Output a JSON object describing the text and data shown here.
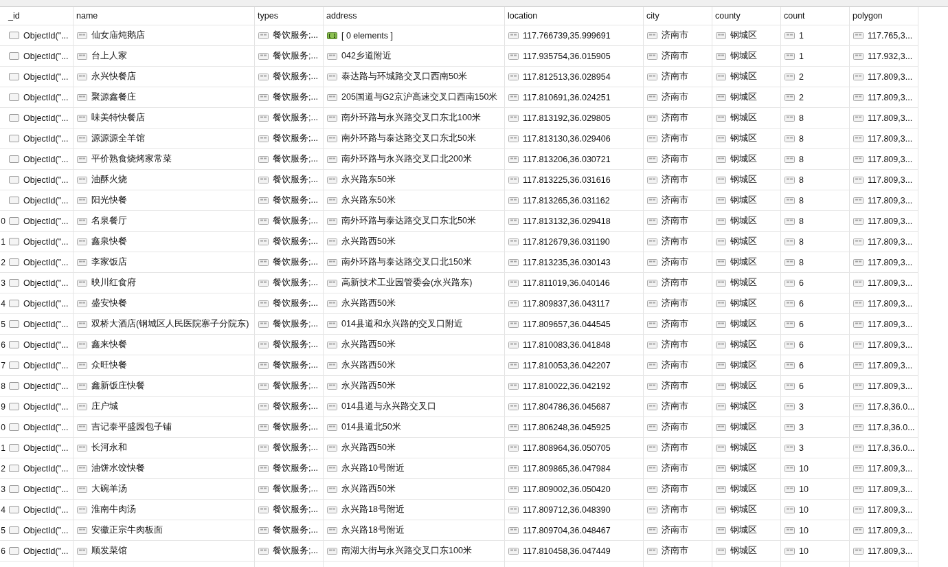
{
  "table": {
    "columns": [
      "_id",
      "name",
      "types",
      "address",
      "location",
      "city",
      "county",
      "count",
      "polygon"
    ],
    "rows": [
      {
        "row_number": "",
        "cells": [
          {
            "kind": "objectid",
            "text": "ObjectId(\"..."
          },
          {
            "kind": "string",
            "text": "仙女庙炖鹅店"
          },
          {
            "kind": "string",
            "text": "餐饮服务;..."
          },
          {
            "kind": "array",
            "text": "[ 0 elements ]"
          },
          {
            "kind": "string",
            "text": "117.766739,35.999691"
          },
          {
            "kind": "string",
            "text": "济南市"
          },
          {
            "kind": "string",
            "text": "钢城区"
          },
          {
            "kind": "string",
            "text": "1"
          },
          {
            "kind": "string",
            "text": "117.765,3..."
          }
        ]
      },
      {
        "row_number": "",
        "cells": [
          {
            "kind": "objectid",
            "text": "ObjectId(\"..."
          },
          {
            "kind": "string",
            "text": "台上人家"
          },
          {
            "kind": "string",
            "text": "餐饮服务;..."
          },
          {
            "kind": "string",
            "text": "042乡道附近"
          },
          {
            "kind": "string",
            "text": "117.935754,36.015905"
          },
          {
            "kind": "string",
            "text": "济南市"
          },
          {
            "kind": "string",
            "text": "钢城区"
          },
          {
            "kind": "string",
            "text": "1"
          },
          {
            "kind": "string",
            "text": "117.932,3..."
          }
        ]
      },
      {
        "row_number": "",
        "cells": [
          {
            "kind": "objectid",
            "text": "ObjectId(\"..."
          },
          {
            "kind": "string",
            "text": "永兴快餐店"
          },
          {
            "kind": "string",
            "text": "餐饮服务;..."
          },
          {
            "kind": "string",
            "text": "泰达路与环城路交叉口西南50米"
          },
          {
            "kind": "string",
            "text": "117.812513,36.028954"
          },
          {
            "kind": "string",
            "text": "济南市"
          },
          {
            "kind": "string",
            "text": "钢城区"
          },
          {
            "kind": "string",
            "text": "2"
          },
          {
            "kind": "string",
            "text": "117.809,3..."
          }
        ]
      },
      {
        "row_number": "",
        "cells": [
          {
            "kind": "objectid",
            "text": "ObjectId(\"..."
          },
          {
            "kind": "string",
            "text": "聚源鑫餐庄"
          },
          {
            "kind": "string",
            "text": "餐饮服务;..."
          },
          {
            "kind": "string",
            "text": "205国道与G2京沪高速交叉口西南150米"
          },
          {
            "kind": "string",
            "text": "117.810691,36.024251"
          },
          {
            "kind": "string",
            "text": "济南市"
          },
          {
            "kind": "string",
            "text": "钢城区"
          },
          {
            "kind": "string",
            "text": "2"
          },
          {
            "kind": "string",
            "text": "117.809,3..."
          }
        ]
      },
      {
        "row_number": "",
        "cells": [
          {
            "kind": "objectid",
            "text": "ObjectId(\"..."
          },
          {
            "kind": "string",
            "text": "味美特快餐店"
          },
          {
            "kind": "string",
            "text": "餐饮服务;..."
          },
          {
            "kind": "string",
            "text": "南外环路与永兴路交叉口东北100米"
          },
          {
            "kind": "string",
            "text": "117.813192,36.029805"
          },
          {
            "kind": "string",
            "text": "济南市"
          },
          {
            "kind": "string",
            "text": "钢城区"
          },
          {
            "kind": "string",
            "text": "8"
          },
          {
            "kind": "string",
            "text": "117.809,3..."
          }
        ]
      },
      {
        "row_number": "",
        "cells": [
          {
            "kind": "objectid",
            "text": "ObjectId(\"..."
          },
          {
            "kind": "string",
            "text": "源源源全羊馆"
          },
          {
            "kind": "string",
            "text": "餐饮服务;..."
          },
          {
            "kind": "string",
            "text": "南外环路与泰达路交叉口东北50米"
          },
          {
            "kind": "string",
            "text": "117.813130,36.029406"
          },
          {
            "kind": "string",
            "text": "济南市"
          },
          {
            "kind": "string",
            "text": "钢城区"
          },
          {
            "kind": "string",
            "text": "8"
          },
          {
            "kind": "string",
            "text": "117.809,3..."
          }
        ]
      },
      {
        "row_number": "",
        "cells": [
          {
            "kind": "objectid",
            "text": "ObjectId(\"..."
          },
          {
            "kind": "string",
            "text": "平价熟食烧烤家常菜"
          },
          {
            "kind": "string",
            "text": "餐饮服务;..."
          },
          {
            "kind": "string",
            "text": "南外环路与永兴路交叉口北200米"
          },
          {
            "kind": "string",
            "text": "117.813206,36.030721"
          },
          {
            "kind": "string",
            "text": "济南市"
          },
          {
            "kind": "string",
            "text": "钢城区"
          },
          {
            "kind": "string",
            "text": "8"
          },
          {
            "kind": "string",
            "text": "117.809,3..."
          }
        ]
      },
      {
        "row_number": "",
        "cells": [
          {
            "kind": "objectid",
            "text": "ObjectId(\"..."
          },
          {
            "kind": "string",
            "text": "油酥火烧"
          },
          {
            "kind": "string",
            "text": "餐饮服务;..."
          },
          {
            "kind": "string",
            "text": "永兴路东50米"
          },
          {
            "kind": "string",
            "text": "117.813225,36.031616"
          },
          {
            "kind": "string",
            "text": "济南市"
          },
          {
            "kind": "string",
            "text": "钢城区"
          },
          {
            "kind": "string",
            "text": "8"
          },
          {
            "kind": "string",
            "text": "117.809,3..."
          }
        ]
      },
      {
        "row_number": "",
        "cells": [
          {
            "kind": "objectid",
            "text": "ObjectId(\"..."
          },
          {
            "kind": "string",
            "text": "阳光快餐"
          },
          {
            "kind": "string",
            "text": "餐饮服务;..."
          },
          {
            "kind": "string",
            "text": "永兴路东50米"
          },
          {
            "kind": "string",
            "text": "117.813265,36.031162"
          },
          {
            "kind": "string",
            "text": "济南市"
          },
          {
            "kind": "string",
            "text": "钢城区"
          },
          {
            "kind": "string",
            "text": "8"
          },
          {
            "kind": "string",
            "text": "117.809,3..."
          }
        ]
      },
      {
        "row_number": "0",
        "cells": [
          {
            "kind": "objectid",
            "text": "ObjectId(\"..."
          },
          {
            "kind": "string",
            "text": "名泉餐厅"
          },
          {
            "kind": "string",
            "text": "餐饮服务;..."
          },
          {
            "kind": "string",
            "text": "南外环路与泰达路交叉口东北50米"
          },
          {
            "kind": "string",
            "text": "117.813132,36.029418"
          },
          {
            "kind": "string",
            "text": "济南市"
          },
          {
            "kind": "string",
            "text": "钢城区"
          },
          {
            "kind": "string",
            "text": "8"
          },
          {
            "kind": "string",
            "text": "117.809,3..."
          }
        ]
      },
      {
        "row_number": "1",
        "cells": [
          {
            "kind": "objectid",
            "text": "ObjectId(\"..."
          },
          {
            "kind": "string",
            "text": "鑫泉快餐"
          },
          {
            "kind": "string",
            "text": "餐饮服务;..."
          },
          {
            "kind": "string",
            "text": "永兴路西50米"
          },
          {
            "kind": "string",
            "text": "117.812679,36.031190"
          },
          {
            "kind": "string",
            "text": "济南市"
          },
          {
            "kind": "string",
            "text": "钢城区"
          },
          {
            "kind": "string",
            "text": "8"
          },
          {
            "kind": "string",
            "text": "117.809,3..."
          }
        ]
      },
      {
        "row_number": "2",
        "cells": [
          {
            "kind": "objectid",
            "text": "ObjectId(\"..."
          },
          {
            "kind": "string",
            "text": "李家饭店"
          },
          {
            "kind": "string",
            "text": "餐饮服务;..."
          },
          {
            "kind": "string",
            "text": "南外环路与泰达路交叉口北150米"
          },
          {
            "kind": "string",
            "text": "117.813235,36.030143"
          },
          {
            "kind": "string",
            "text": "济南市"
          },
          {
            "kind": "string",
            "text": "钢城区"
          },
          {
            "kind": "string",
            "text": "8"
          },
          {
            "kind": "string",
            "text": "117.809,3..."
          }
        ]
      },
      {
        "row_number": "3",
        "cells": [
          {
            "kind": "objectid",
            "text": "ObjectId(\"..."
          },
          {
            "kind": "string",
            "text": "映川红食府"
          },
          {
            "kind": "string",
            "text": "餐饮服务;..."
          },
          {
            "kind": "string",
            "text": "高新技术工业园管委会(永兴路东)"
          },
          {
            "kind": "string",
            "text": "117.811019,36.040146"
          },
          {
            "kind": "string",
            "text": "济南市"
          },
          {
            "kind": "string",
            "text": "钢城区"
          },
          {
            "kind": "string",
            "text": "6"
          },
          {
            "kind": "string",
            "text": "117.809,3..."
          }
        ]
      },
      {
        "row_number": "4",
        "cells": [
          {
            "kind": "objectid",
            "text": "ObjectId(\"..."
          },
          {
            "kind": "string",
            "text": "盛安快餐"
          },
          {
            "kind": "string",
            "text": "餐饮服务;..."
          },
          {
            "kind": "string",
            "text": "永兴路西50米"
          },
          {
            "kind": "string",
            "text": "117.809837,36.043117"
          },
          {
            "kind": "string",
            "text": "济南市"
          },
          {
            "kind": "string",
            "text": "钢城区"
          },
          {
            "kind": "string",
            "text": "6"
          },
          {
            "kind": "string",
            "text": "117.809,3..."
          }
        ]
      },
      {
        "row_number": "5",
        "cells": [
          {
            "kind": "objectid",
            "text": "ObjectId(\"..."
          },
          {
            "kind": "string",
            "text": "双桥大酒店(钢城区人民医院寨子分院东)"
          },
          {
            "kind": "string",
            "text": "餐饮服务;..."
          },
          {
            "kind": "string",
            "text": "014县道和永兴路的交叉口附近"
          },
          {
            "kind": "string",
            "text": "117.809657,36.044545"
          },
          {
            "kind": "string",
            "text": "济南市"
          },
          {
            "kind": "string",
            "text": "钢城区"
          },
          {
            "kind": "string",
            "text": "6"
          },
          {
            "kind": "string",
            "text": "117.809,3..."
          }
        ]
      },
      {
        "row_number": "6",
        "cells": [
          {
            "kind": "objectid",
            "text": "ObjectId(\"..."
          },
          {
            "kind": "string",
            "text": "鑫来快餐"
          },
          {
            "kind": "string",
            "text": "餐饮服务;..."
          },
          {
            "kind": "string",
            "text": "永兴路西50米"
          },
          {
            "kind": "string",
            "text": "117.810083,36.041848"
          },
          {
            "kind": "string",
            "text": "济南市"
          },
          {
            "kind": "string",
            "text": "钢城区"
          },
          {
            "kind": "string",
            "text": "6"
          },
          {
            "kind": "string",
            "text": "117.809,3..."
          }
        ]
      },
      {
        "row_number": "7",
        "cells": [
          {
            "kind": "objectid",
            "text": "ObjectId(\"..."
          },
          {
            "kind": "string",
            "text": "众旺快餐"
          },
          {
            "kind": "string",
            "text": "餐饮服务;..."
          },
          {
            "kind": "string",
            "text": "永兴路西50米"
          },
          {
            "kind": "string",
            "text": "117.810053,36.042207"
          },
          {
            "kind": "string",
            "text": "济南市"
          },
          {
            "kind": "string",
            "text": "钢城区"
          },
          {
            "kind": "string",
            "text": "6"
          },
          {
            "kind": "string",
            "text": "117.809,3..."
          }
        ]
      },
      {
        "row_number": "8",
        "cells": [
          {
            "kind": "objectid",
            "text": "ObjectId(\"..."
          },
          {
            "kind": "string",
            "text": "鑫新饭庄快餐"
          },
          {
            "kind": "string",
            "text": "餐饮服务;..."
          },
          {
            "kind": "string",
            "text": "永兴路西50米"
          },
          {
            "kind": "string",
            "text": "117.810022,36.042192"
          },
          {
            "kind": "string",
            "text": "济南市"
          },
          {
            "kind": "string",
            "text": "钢城区"
          },
          {
            "kind": "string",
            "text": "6"
          },
          {
            "kind": "string",
            "text": "117.809,3..."
          }
        ]
      },
      {
        "row_number": "9",
        "cells": [
          {
            "kind": "objectid",
            "text": "ObjectId(\"..."
          },
          {
            "kind": "string",
            "text": "庄户城"
          },
          {
            "kind": "string",
            "text": "餐饮服务;..."
          },
          {
            "kind": "string",
            "text": "014县道与永兴路交叉口"
          },
          {
            "kind": "string",
            "text": "117.804786,36.045687"
          },
          {
            "kind": "string",
            "text": "济南市"
          },
          {
            "kind": "string",
            "text": "钢城区"
          },
          {
            "kind": "string",
            "text": "3"
          },
          {
            "kind": "string",
            "text": "117.8,36.0..."
          }
        ]
      },
      {
        "row_number": "0",
        "cells": [
          {
            "kind": "objectid",
            "text": "ObjectId(\"..."
          },
          {
            "kind": "string",
            "text": "吉记泰平盛园包子铺"
          },
          {
            "kind": "string",
            "text": "餐饮服务;..."
          },
          {
            "kind": "string",
            "text": "014县道北50米"
          },
          {
            "kind": "string",
            "text": "117.806248,36.045925"
          },
          {
            "kind": "string",
            "text": "济南市"
          },
          {
            "kind": "string",
            "text": "钢城区"
          },
          {
            "kind": "string",
            "text": "3"
          },
          {
            "kind": "string",
            "text": "117.8,36.0..."
          }
        ]
      },
      {
        "row_number": "1",
        "cells": [
          {
            "kind": "objectid",
            "text": "ObjectId(\"..."
          },
          {
            "kind": "string",
            "text": "长河永和"
          },
          {
            "kind": "string",
            "text": "餐饮服务;..."
          },
          {
            "kind": "string",
            "text": "永兴路西50米"
          },
          {
            "kind": "string",
            "text": "117.808964,36.050705"
          },
          {
            "kind": "string",
            "text": "济南市"
          },
          {
            "kind": "string",
            "text": "钢城区"
          },
          {
            "kind": "string",
            "text": "3"
          },
          {
            "kind": "string",
            "text": "117.8,36.0..."
          }
        ]
      },
      {
        "row_number": "2",
        "cells": [
          {
            "kind": "objectid",
            "text": "ObjectId(\"..."
          },
          {
            "kind": "string",
            "text": "油饼水饺快餐"
          },
          {
            "kind": "string",
            "text": "餐饮服务;..."
          },
          {
            "kind": "string",
            "text": "永兴路10号附近"
          },
          {
            "kind": "string",
            "text": "117.809865,36.047984"
          },
          {
            "kind": "string",
            "text": "济南市"
          },
          {
            "kind": "string",
            "text": "钢城区"
          },
          {
            "kind": "string",
            "text": "10"
          },
          {
            "kind": "string",
            "text": "117.809,3..."
          }
        ]
      },
      {
        "row_number": "3",
        "cells": [
          {
            "kind": "objectid",
            "text": "ObjectId(\"..."
          },
          {
            "kind": "string",
            "text": "大碗羊汤"
          },
          {
            "kind": "string",
            "text": "餐饮服务;..."
          },
          {
            "kind": "string",
            "text": "永兴路西50米"
          },
          {
            "kind": "string",
            "text": "117.809002,36.050420"
          },
          {
            "kind": "string",
            "text": "济南市"
          },
          {
            "kind": "string",
            "text": "钢城区"
          },
          {
            "kind": "string",
            "text": "10"
          },
          {
            "kind": "string",
            "text": "117.809,3..."
          }
        ]
      },
      {
        "row_number": "4",
        "cells": [
          {
            "kind": "objectid",
            "text": "ObjectId(\"..."
          },
          {
            "kind": "string",
            "text": "淮南牛肉汤"
          },
          {
            "kind": "string",
            "text": "餐饮服务;..."
          },
          {
            "kind": "string",
            "text": "永兴路18号附近"
          },
          {
            "kind": "string",
            "text": "117.809712,36.048390"
          },
          {
            "kind": "string",
            "text": "济南市"
          },
          {
            "kind": "string",
            "text": "钢城区"
          },
          {
            "kind": "string",
            "text": "10"
          },
          {
            "kind": "string",
            "text": "117.809,3..."
          }
        ]
      },
      {
        "row_number": "5",
        "cells": [
          {
            "kind": "objectid",
            "text": "ObjectId(\"..."
          },
          {
            "kind": "string",
            "text": "安徽正宗牛肉板面"
          },
          {
            "kind": "string",
            "text": "餐饮服务;..."
          },
          {
            "kind": "string",
            "text": "永兴路18号附近"
          },
          {
            "kind": "string",
            "text": "117.809704,36.048467"
          },
          {
            "kind": "string",
            "text": "济南市"
          },
          {
            "kind": "string",
            "text": "钢城区"
          },
          {
            "kind": "string",
            "text": "10"
          },
          {
            "kind": "string",
            "text": "117.809,3..."
          }
        ]
      },
      {
        "row_number": "6",
        "cells": [
          {
            "kind": "objectid",
            "text": "ObjectId(\"..."
          },
          {
            "kind": "string",
            "text": "顺发菜馆"
          },
          {
            "kind": "string",
            "text": "餐饮服务;..."
          },
          {
            "kind": "string",
            "text": "南湖大街与永兴路交叉口东100米"
          },
          {
            "kind": "string",
            "text": "117.810458,36.047449"
          },
          {
            "kind": "string",
            "text": "济南市"
          },
          {
            "kind": "string",
            "text": "钢城区"
          },
          {
            "kind": "string",
            "text": "10"
          },
          {
            "kind": "string",
            "text": "117.809,3..."
          }
        ]
      }
    ]
  }
}
